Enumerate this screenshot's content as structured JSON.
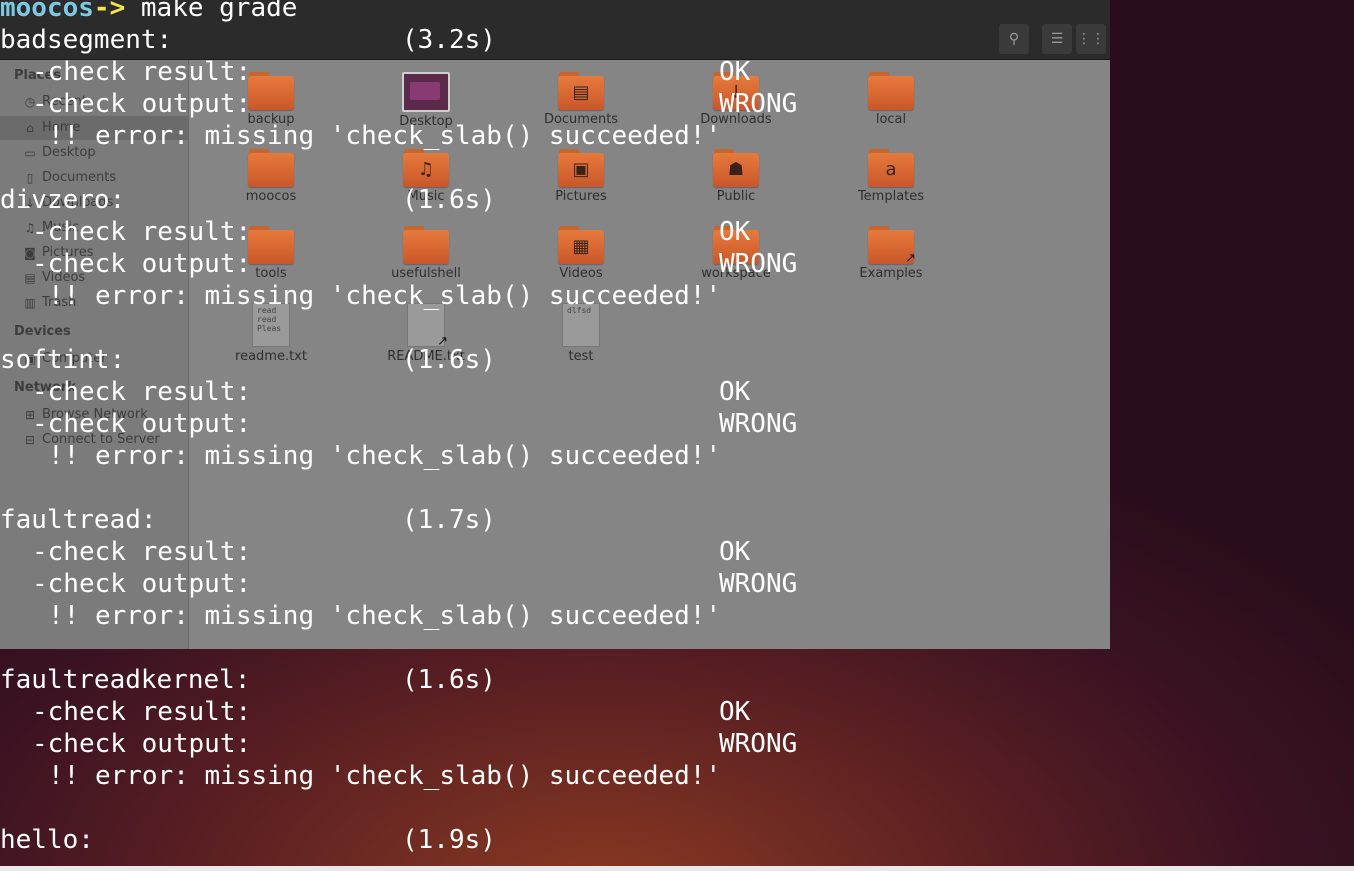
{
  "terminal": {
    "prompt": {
      "host": "moocos",
      "arrow": "->",
      "command": " make grade"
    },
    "tests": [
      {
        "name": "badsegment:",
        "time": "(3.2s)",
        "result_label": "-check result:",
        "result_status": "OK",
        "output_label": "-check output:",
        "output_status": "WRONG",
        "error": "!! error: missing 'check_slab() succeeded!'"
      },
      {
        "name": "divzero:",
        "time": "(1.6s)",
        "result_label": "-check result:",
        "result_status": "OK",
        "output_label": "-check output:",
        "output_status": "WRONG",
        "error": "!! error: missing 'check_slab() succeeded!'"
      },
      {
        "name": "softint:",
        "time": "(1.6s)",
        "result_label": "-check result:",
        "result_status": "OK",
        "output_label": "-check output:",
        "output_status": "WRONG",
        "error": "!! error: missing 'check_slab() succeeded!'"
      },
      {
        "name": "faultread:",
        "time": "(1.7s)",
        "result_label": "-check result:",
        "result_status": "OK",
        "output_label": "-check output:",
        "output_status": "WRONG",
        "error": "!! error: missing 'check_slab() succeeded!'"
      },
      {
        "name": "faultreadkernel:",
        "time": "(1.6s)",
        "result_label": "-check result:",
        "result_status": "OK",
        "output_label": "-check output:",
        "output_status": "WRONG",
        "error": "!! error: missing 'check_slab() succeeded!'"
      },
      {
        "name": "hello:",
        "time": "(1.9s)"
      }
    ]
  },
  "file_manager": {
    "header_buttons": [
      {
        "icon": "search-icon",
        "glyph": "⚲"
      },
      {
        "icon": "list-view-icon",
        "glyph": "☰"
      },
      {
        "icon": "grid-view-icon",
        "glyph": "⋮⋮"
      }
    ],
    "sidebar": {
      "places_heading": "Places",
      "places": [
        {
          "label": "Recent",
          "icon": "recent-icon",
          "glyph": "◷"
        },
        {
          "label": "Home",
          "icon": "home-icon",
          "glyph": "⌂"
        },
        {
          "label": "Desktop",
          "icon": "desktop-icon",
          "glyph": "▭"
        },
        {
          "label": "Documents",
          "icon": "documents-icon",
          "glyph": "▯"
        },
        {
          "label": "Downloads",
          "icon": "downloads-icon",
          "glyph": "↓"
        },
        {
          "label": "Music",
          "icon": "music-icon",
          "glyph": "♫"
        },
        {
          "label": "Pictures",
          "icon": "pictures-icon",
          "glyph": "◙"
        },
        {
          "label": "Videos",
          "icon": "videos-icon",
          "glyph": "▤"
        },
        {
          "label": "Trash",
          "icon": "trash-icon",
          "glyph": "▥"
        }
      ],
      "devices_heading": "Devices",
      "devices": [
        {
          "label": "Computer",
          "icon": "computer-icon",
          "glyph": "▣"
        }
      ],
      "network_heading": "Network",
      "network": [
        {
          "label": "Browse Network",
          "icon": "network-icon",
          "glyph": "⊞"
        },
        {
          "label": "Connect to Server",
          "icon": "server-icon",
          "glyph": "⊟"
        }
      ]
    },
    "files": [
      {
        "name": "backup",
        "kind": "folder",
        "emblem": ""
      },
      {
        "name": "Desktop",
        "kind": "desktop",
        "emblem": ""
      },
      {
        "name": "Documents",
        "kind": "folder",
        "emblem": "▤"
      },
      {
        "name": "Downloads",
        "kind": "folder",
        "emblem": "↓"
      },
      {
        "name": "local",
        "kind": "folder",
        "emblem": ""
      },
      {
        "name": "moocos",
        "kind": "folder",
        "emblem": ""
      },
      {
        "name": "Music",
        "kind": "folder",
        "emblem": "♫"
      },
      {
        "name": "Pictures",
        "kind": "folder",
        "emblem": "▣"
      },
      {
        "name": "Public",
        "kind": "folder",
        "emblem": "☗"
      },
      {
        "name": "Templates",
        "kind": "folder",
        "emblem": "a"
      },
      {
        "name": "tools",
        "kind": "folder",
        "emblem": ""
      },
      {
        "name": "usefulshell",
        "kind": "folder",
        "emblem": ""
      },
      {
        "name": "Videos",
        "kind": "folder",
        "emblem": "▦"
      },
      {
        "name": "workspace",
        "kind": "folder",
        "emblem": ""
      },
      {
        "name": "Examples",
        "kind": "folder-link",
        "emblem": ""
      },
      {
        "name": "readme.txt",
        "kind": "text",
        "preview": "read\nread\nPleas"
      },
      {
        "name": "README.txt",
        "kind": "text-link",
        "preview": ""
      },
      {
        "name": "test",
        "kind": "text",
        "preview": "dlfsd"
      }
    ]
  }
}
